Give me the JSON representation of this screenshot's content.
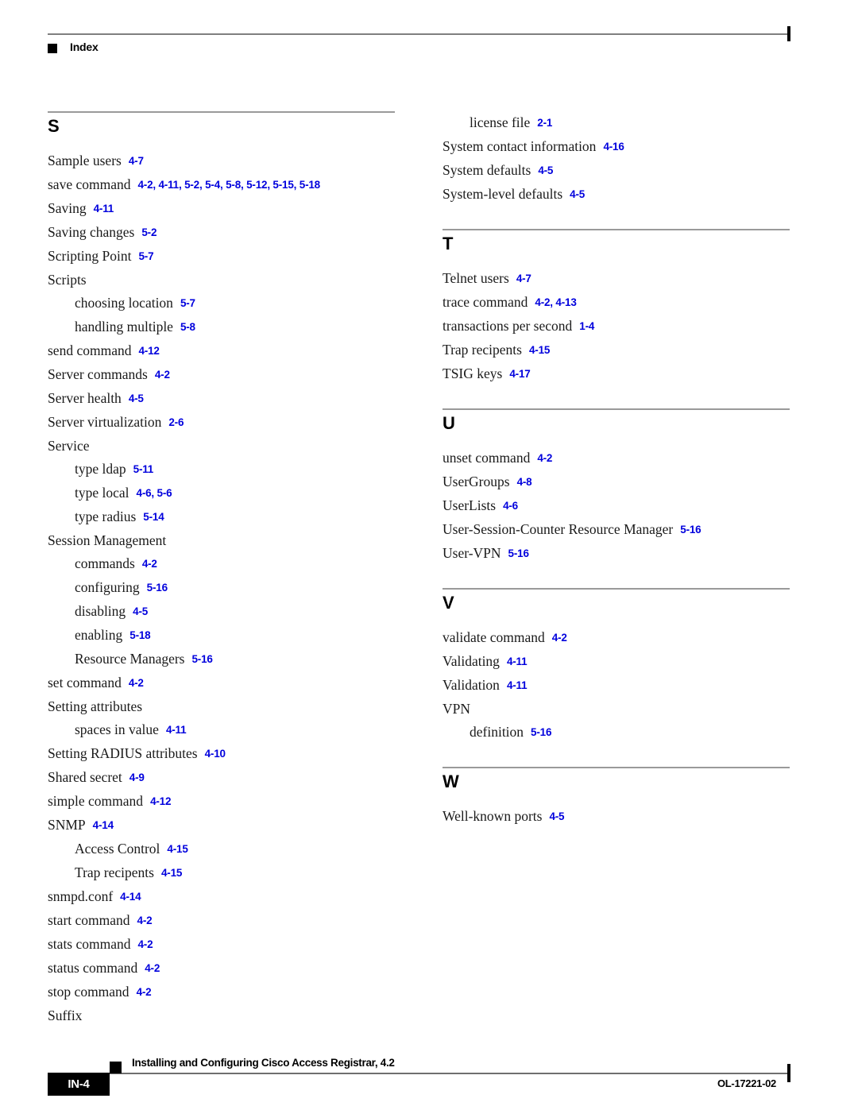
{
  "header": {
    "bullet_icon": "black-square-icon",
    "title": "Index"
  },
  "columns": [
    {
      "id": "left",
      "sections": [
        {
          "letter": "S",
          "entries": [
            {
              "level": 1,
              "term": "Sample users",
              "refs": "4-7"
            },
            {
              "level": 1,
              "term": "save command",
              "refs": "4-2, 4-11, 5-2, 5-4, 5-8, 5-12, 5-15, 5-18"
            },
            {
              "level": 1,
              "term": "Saving",
              "refs": "4-11"
            },
            {
              "level": 1,
              "term": "Saving changes",
              "refs": "5-2"
            },
            {
              "level": 1,
              "term": "Scripting Point",
              "refs": "5-7"
            },
            {
              "level": 1,
              "term": "Scripts",
              "refs": ""
            },
            {
              "level": 2,
              "term": "choosing location",
              "refs": "5-7"
            },
            {
              "level": 2,
              "term": "handling multiple",
              "refs": "5-8"
            },
            {
              "level": 1,
              "term": "send command",
              "refs": "4-12"
            },
            {
              "level": 1,
              "term": "Server commands",
              "refs": "4-2"
            },
            {
              "level": 1,
              "term": "Server health",
              "refs": "4-5"
            },
            {
              "level": 1,
              "term": "Server virtualization",
              "refs": "2-6"
            },
            {
              "level": 1,
              "term": "Service",
              "refs": ""
            },
            {
              "level": 2,
              "term": "type ldap",
              "refs": "5-11"
            },
            {
              "level": 2,
              "term": "type local",
              "refs": "4-6, 5-6"
            },
            {
              "level": 2,
              "term": "type radius",
              "refs": "5-14"
            },
            {
              "level": 1,
              "term": "Session Management",
              "refs": ""
            },
            {
              "level": 2,
              "term": "commands",
              "refs": "4-2"
            },
            {
              "level": 2,
              "term": "configuring",
              "refs": "5-16"
            },
            {
              "level": 2,
              "term": "disabling",
              "refs": "4-5"
            },
            {
              "level": 2,
              "term": "enabling",
              "refs": "5-18"
            },
            {
              "level": 2,
              "term": "Resource Managers",
              "refs": "5-16"
            },
            {
              "level": 1,
              "term": "set command",
              "refs": "4-2"
            },
            {
              "level": 1,
              "term": "Setting attributes",
              "refs": ""
            },
            {
              "level": 2,
              "term": "spaces in value",
              "refs": "4-11"
            },
            {
              "level": 1,
              "term": "Setting RADIUS attributes",
              "refs": "4-10"
            },
            {
              "level": 1,
              "term": "Shared secret",
              "refs": "4-9"
            },
            {
              "level": 1,
              "term": "simple command",
              "refs": "4-12"
            },
            {
              "level": 1,
              "term": "SNMP",
              "refs": "4-14"
            },
            {
              "level": 2,
              "term": "Access Control",
              "refs": "4-15"
            },
            {
              "level": 2,
              "term": "Trap recipents",
              "refs": "4-15"
            },
            {
              "level": 1,
              "term": "snmpd.conf",
              "refs": "4-14"
            },
            {
              "level": 1,
              "term": "start command",
              "refs": "4-2"
            },
            {
              "level": 1,
              "term": "stats command",
              "refs": "4-2"
            },
            {
              "level": 1,
              "term": "status command",
              "refs": "4-2"
            },
            {
              "level": 1,
              "term": "stop command",
              "refs": "4-2"
            },
            {
              "level": 1,
              "term": "Suffix",
              "refs": ""
            }
          ]
        }
      ]
    },
    {
      "id": "right",
      "sections": [
        {
          "letter": "",
          "entries": [
            {
              "level": 2,
              "term": "license file",
              "refs": "2-1"
            },
            {
              "level": 1,
              "term": "System contact information",
              "refs": "4-16"
            },
            {
              "level": 1,
              "term": "System defaults",
              "refs": "4-5"
            },
            {
              "level": 1,
              "term": "System-level defaults",
              "refs": "4-5"
            }
          ]
        },
        {
          "letter": "T",
          "entries": [
            {
              "level": 1,
              "term": "Telnet users",
              "refs": "4-7"
            },
            {
              "level": 1,
              "term": "trace command",
              "refs": "4-2, 4-13"
            },
            {
              "level": 1,
              "term": "transactions per second",
              "refs": "1-4"
            },
            {
              "level": 1,
              "term": "Trap recipents",
              "refs": "4-15"
            },
            {
              "level": 1,
              "term": "TSIG keys",
              "refs": "4-17"
            }
          ]
        },
        {
          "letter": "U",
          "entries": [
            {
              "level": 1,
              "term": "unset command",
              "refs": "4-2"
            },
            {
              "level": 1,
              "term": "UserGroups",
              "refs": "4-8"
            },
            {
              "level": 1,
              "term": "UserLists",
              "refs": "4-6"
            },
            {
              "level": 1,
              "term": "User-Session-Counter Resource Manager",
              "refs": "5-16"
            },
            {
              "level": 1,
              "term": "User-VPN",
              "refs": "5-16"
            }
          ]
        },
        {
          "letter": "V",
          "entries": [
            {
              "level": 1,
              "term": "validate command",
              "refs": "4-2"
            },
            {
              "level": 1,
              "term": "Validating",
              "refs": "4-11"
            },
            {
              "level": 1,
              "term": "Validation",
              "refs": "4-11"
            },
            {
              "level": 1,
              "term": "VPN",
              "refs": ""
            },
            {
              "level": 2,
              "term": "definition",
              "refs": "5-16"
            }
          ]
        },
        {
          "letter": "W",
          "entries": [
            {
              "level": 1,
              "term": "Well-known ports",
              "refs": "4-5"
            }
          ]
        }
      ]
    }
  ],
  "footer": {
    "page_number": "IN-4",
    "book_title": "Installing and Configuring Cisco Access Registrar, 4.2",
    "document_id": "OL-17221-02",
    "square_icon": "black-square-icon"
  },
  "colors": {
    "page_reference": "#0000dd",
    "rule": "#9a9a9a",
    "text": "#1a1a1a"
  }
}
